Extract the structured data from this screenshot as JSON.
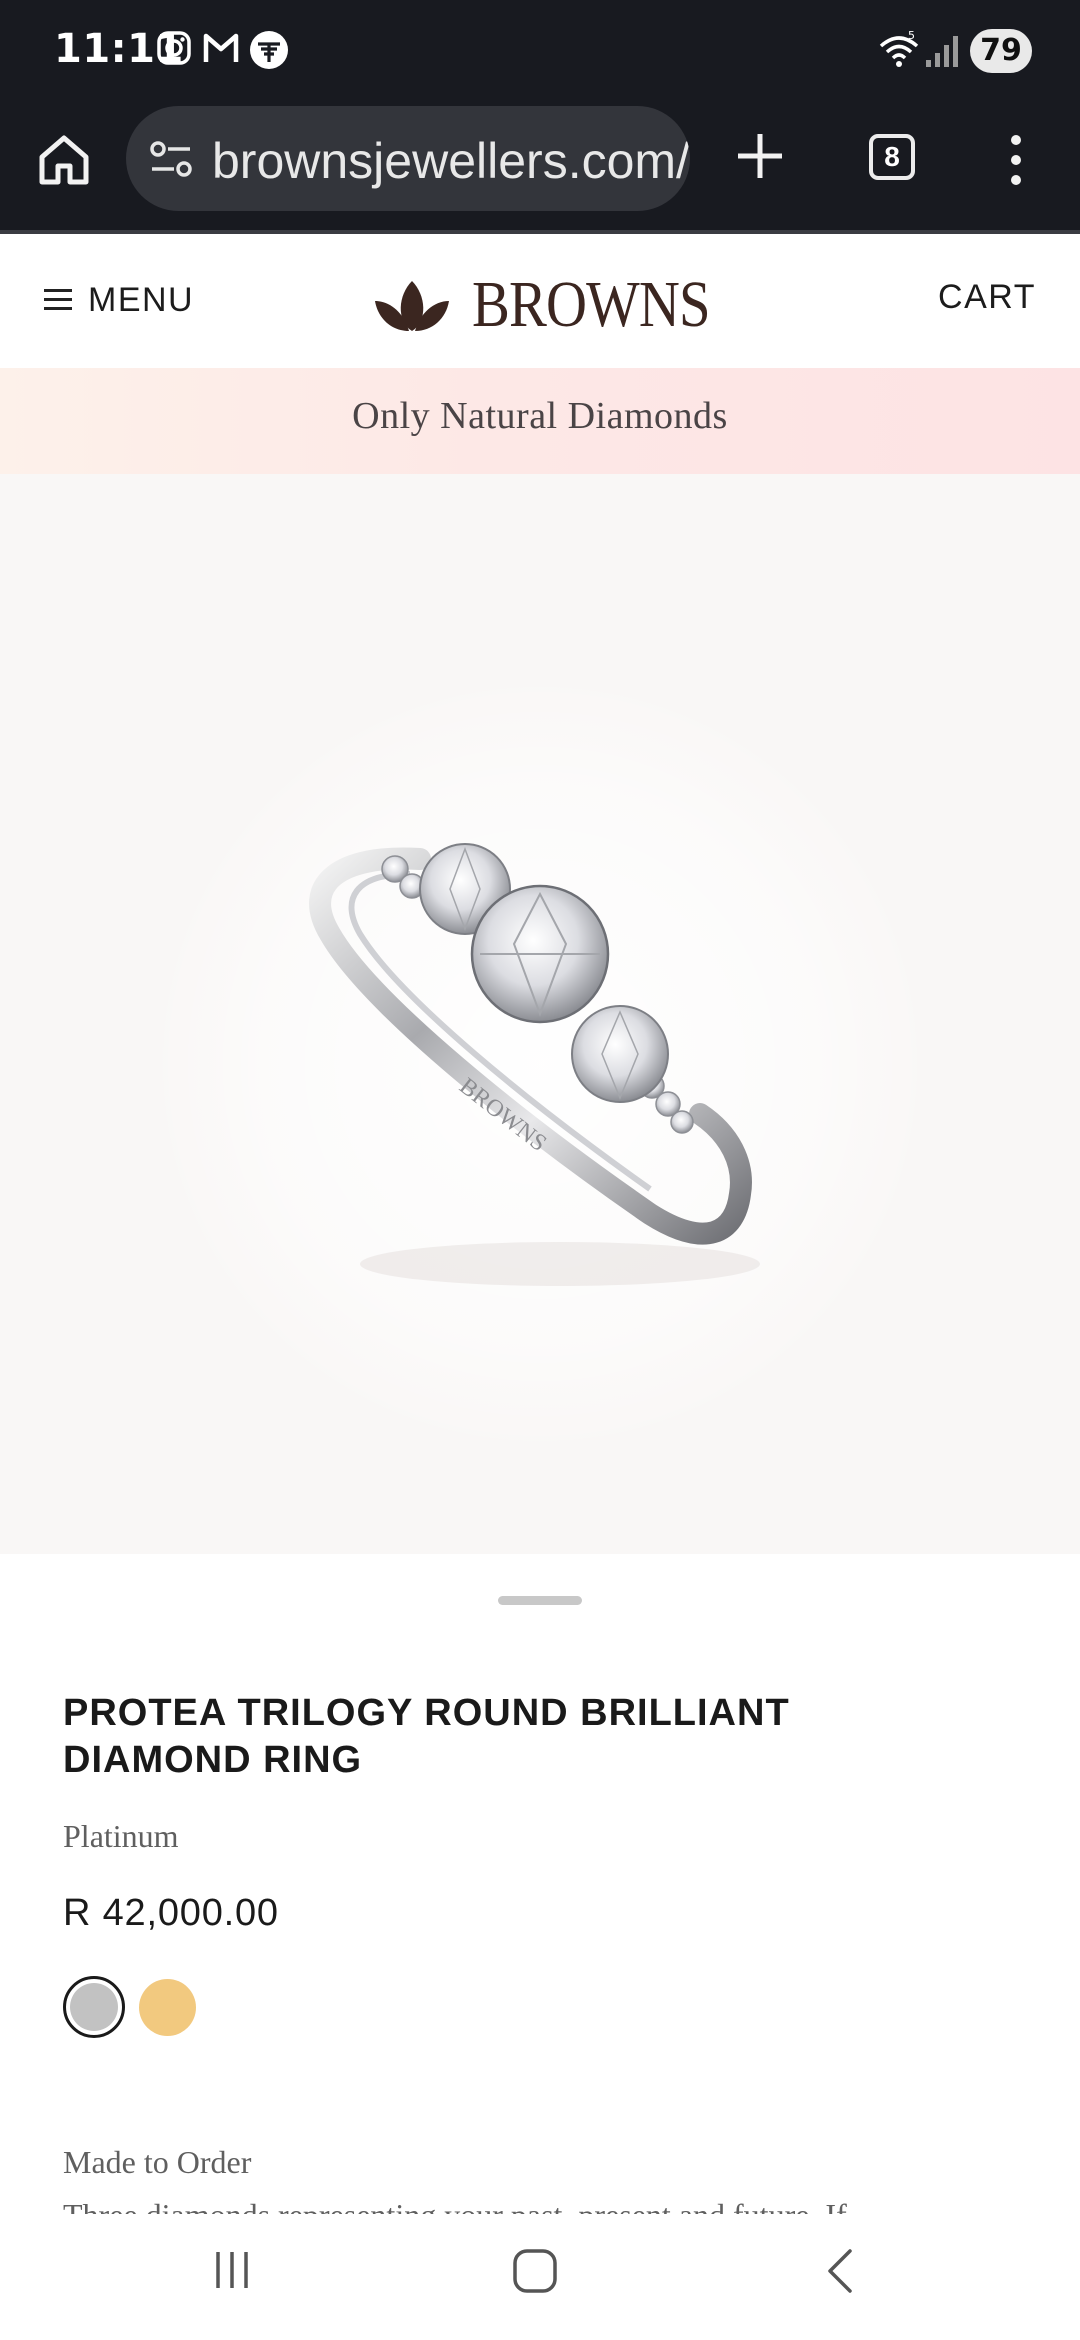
{
  "status_bar": {
    "time": "11:11",
    "battery": "79",
    "notification_icons": [
      "instagram-icon",
      "gmail-icon",
      "bank-app-icon"
    ],
    "system_icons": [
      "wifi-icon",
      "signal-icon"
    ]
  },
  "browser": {
    "url": "brownsjewellers.com/",
    "tab_count": "8",
    "icons": [
      "home-icon",
      "site-settings-icon",
      "new-tab-icon",
      "tab-switcher-icon",
      "overflow-menu-icon"
    ]
  },
  "site_header": {
    "menu_label": "MENU",
    "logo_text": "BROWNS",
    "cart_label": "CART"
  },
  "promo_banner": {
    "text": "Only Natural Diamonds"
  },
  "product": {
    "image_engraving": "BROWNS",
    "title": "PROTEA TRILOGY ROUND BRILLIANT DIAMOND RING",
    "metal": "Platinum",
    "price": "R 42,000.00",
    "swatches": [
      {
        "name": "Platinum",
        "color": "#c2c2c2",
        "selected": true
      },
      {
        "name": "Yellow Gold",
        "color": "#f2c97f",
        "selected": false
      }
    ],
    "availability": "Made to Order",
    "description": "Three diamonds representing your past, present and future. If"
  },
  "colors": {
    "status_bar_bg": "#181a20",
    "url_pill_bg": "#33353b",
    "logo_brown": "#3b2620",
    "banner_pink": "#fde6e5"
  },
  "nav_bar": {
    "icons": [
      "recent-apps-icon",
      "home-nav-icon",
      "back-icon"
    ]
  }
}
